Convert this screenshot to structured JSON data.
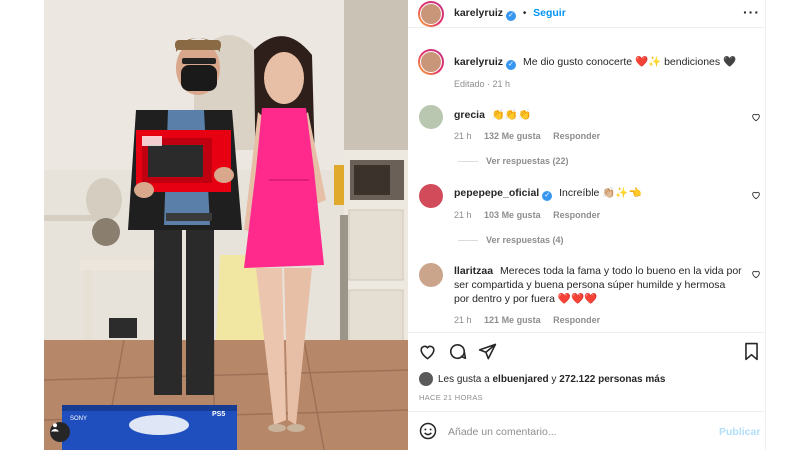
{
  "post": {
    "author": "karelyruiz",
    "separator": "•",
    "follow_label": "Seguir",
    "caption_user": "karelyruiz",
    "caption_text": "Me dio gusto conocerte ❤️✨ bendiciones 🖤",
    "edited": "Editado · 21 h"
  },
  "photo": {
    "box_brand": "SONY",
    "box_label": "PS5"
  },
  "comments": [
    {
      "user": "grecia",
      "verified": false,
      "text": "👏👏👏",
      "time": "21 h",
      "likes": "132 Me gusta",
      "reply": "Responder",
      "view_replies": "Ver respuestas (22)"
    },
    {
      "user": "pepepepe_oficial",
      "verified": true,
      "text": "Increíble 👏🏼✨👈",
      "time": "21 h",
      "likes": "103 Me gusta",
      "reply": "Responder",
      "view_replies": "Ver respuestas (4)"
    },
    {
      "user": "llaritzaa",
      "verified": false,
      "text_lines": [
        "Mereces toda la fama y todo lo bueno en la vida por",
        "ser compartida y buena persona súper humilde y hermosa",
        "por dentro y por fuera ❤️❤️❤️"
      ],
      "time": "21 h",
      "likes": "121 Me gusta",
      "reply": "Responder"
    }
  ],
  "footer": {
    "likes_prefix": "Les gusta a",
    "likes_user": "elbuenjared",
    "likes_and": "y",
    "likes_count": "272.122 personas más",
    "posted_ago": "HACE 21 HORAS",
    "comment_placeholder": "Añade un comentario...",
    "publish_label": "Publicar"
  },
  "colors": {
    "accent": "#0095f6",
    "verified": "#3897f0",
    "dress": "#ff2a8c",
    "switch_red": "#e60012",
    "ps5_blue": "#1f4fbf"
  },
  "icons": [
    "heart-icon",
    "comment-icon",
    "share-icon",
    "bookmark-icon",
    "emoji-icon",
    "more-icon",
    "verified-icon",
    "user-tag-icon"
  ]
}
